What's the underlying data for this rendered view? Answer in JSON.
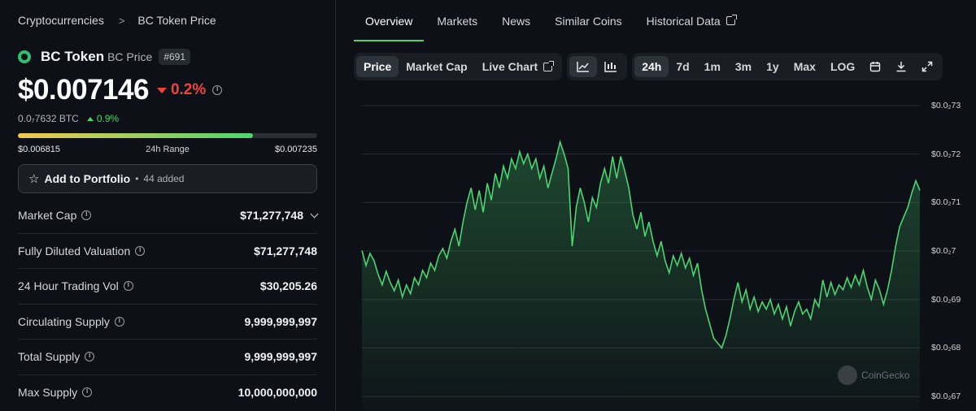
{
  "breadcrumb": {
    "root": "Cryptocurrencies",
    "separator": ">",
    "current": "BC Token Price"
  },
  "coin": {
    "name": "BC Token",
    "symbol": "BC Price",
    "rank": "#691",
    "price": "$0.007146",
    "change_24h": "0.2%",
    "btc_price": "0.0₇7632 BTC",
    "btc_change": "0.9%",
    "range_low": "$0.006815",
    "range_label": "24h Range",
    "range_high": "$0.007235",
    "range_position": 0.786
  },
  "portfolio": {
    "label": "Add to Portfolio",
    "separator": "•",
    "count": "44 added"
  },
  "stats": [
    {
      "label": "Market Cap",
      "value": "$71,277,748"
    },
    {
      "label": "Fully Diluted Valuation",
      "value": "$71,277,748"
    },
    {
      "label": "24 Hour Trading Vol",
      "value": "$30,205.26"
    },
    {
      "label": "Circulating Supply",
      "value": "9,999,999,997"
    },
    {
      "label": "Total Supply",
      "value": "9,999,999,997"
    },
    {
      "label": "Max Supply",
      "value": "10,000,000,000"
    }
  ],
  "tabs": [
    "Overview",
    "Markets",
    "News",
    "Similar Coins",
    "Historical Data"
  ],
  "chart_types": [
    "Price",
    "Market Cap",
    "Live Chart"
  ],
  "ranges": [
    "24h",
    "7d",
    "1m",
    "3m",
    "1y",
    "Max",
    "LOG"
  ],
  "y_labels": [
    "$0.0₂73",
    "$0.0₂72",
    "$0.0₂71",
    "$0.0₂7",
    "$0.0₂69",
    "$0.0₂68",
    "$0.0₂67"
  ],
  "watermark": "CoinGecko",
  "colors": {
    "accent": "#4cd470",
    "negative": "#f0443a",
    "background": "#0d1117"
  },
  "chart_data": {
    "type": "area",
    "ylabel": "",
    "ylim": [
      0.00667,
      0.00731
    ],
    "values": [
      0.007001,
      0.00697,
      0.006995,
      0.00698,
      0.006952,
      0.00693,
      0.006958,
      0.006935,
      0.006918,
      0.00694,
      0.006905,
      0.00693,
      0.006912,
      0.006945,
      0.00693,
      0.00696,
      0.006945,
      0.006975,
      0.00696,
      0.00699,
      0.007005,
      0.006985,
      0.00702,
      0.007045,
      0.00701,
      0.00706,
      0.0071,
      0.00713,
      0.007085,
      0.007125,
      0.00708,
      0.00714,
      0.007105,
      0.00716,
      0.00713,
      0.007175,
      0.00715,
      0.00719,
      0.00717,
      0.007205,
      0.00718,
      0.0072,
      0.00717,
      0.00719,
      0.00715,
      0.007175,
      0.00713,
      0.00716,
      0.00719,
      0.007225,
      0.0072,
      0.00717,
      0.00701,
      0.00709,
      0.00713,
      0.0071,
      0.00706,
      0.00711,
      0.00709,
      0.00714,
      0.00717,
      0.00714,
      0.007195,
      0.00715,
      0.007195,
      0.007165,
      0.00713,
      0.007075,
      0.007045,
      0.00708,
      0.00703,
      0.00706,
      0.00702,
      0.00699,
      0.00702,
      0.00698,
      0.006955,
      0.00699,
      0.00697,
      0.006995,
      0.006965,
      0.006985,
      0.00695,
      0.006975,
      0.00692,
      0.00688,
      0.00685,
      0.00682,
      0.00681,
      0.0068,
      0.006825,
      0.00686,
      0.0069,
      0.006935,
      0.006895,
      0.00692,
      0.00688,
      0.006905,
      0.006875,
      0.006895,
      0.00688,
      0.0069,
      0.00687,
      0.00689,
      0.00686,
      0.006885,
      0.006845,
      0.006875,
      0.006895,
      0.00687,
      0.00688,
      0.00686,
      0.0069,
      0.006885,
      0.00694,
      0.006905,
      0.006935,
      0.00691,
      0.00693,
      0.00692,
      0.006945,
      0.006925,
      0.00695,
      0.00693,
      0.00696,
      0.006925,
      0.0069,
      0.00694,
      0.00692,
      0.00689,
      0.00692,
      0.00696,
      0.00701,
      0.00705,
      0.00707,
      0.00709,
      0.00712,
      0.007145,
      0.007125
    ]
  }
}
